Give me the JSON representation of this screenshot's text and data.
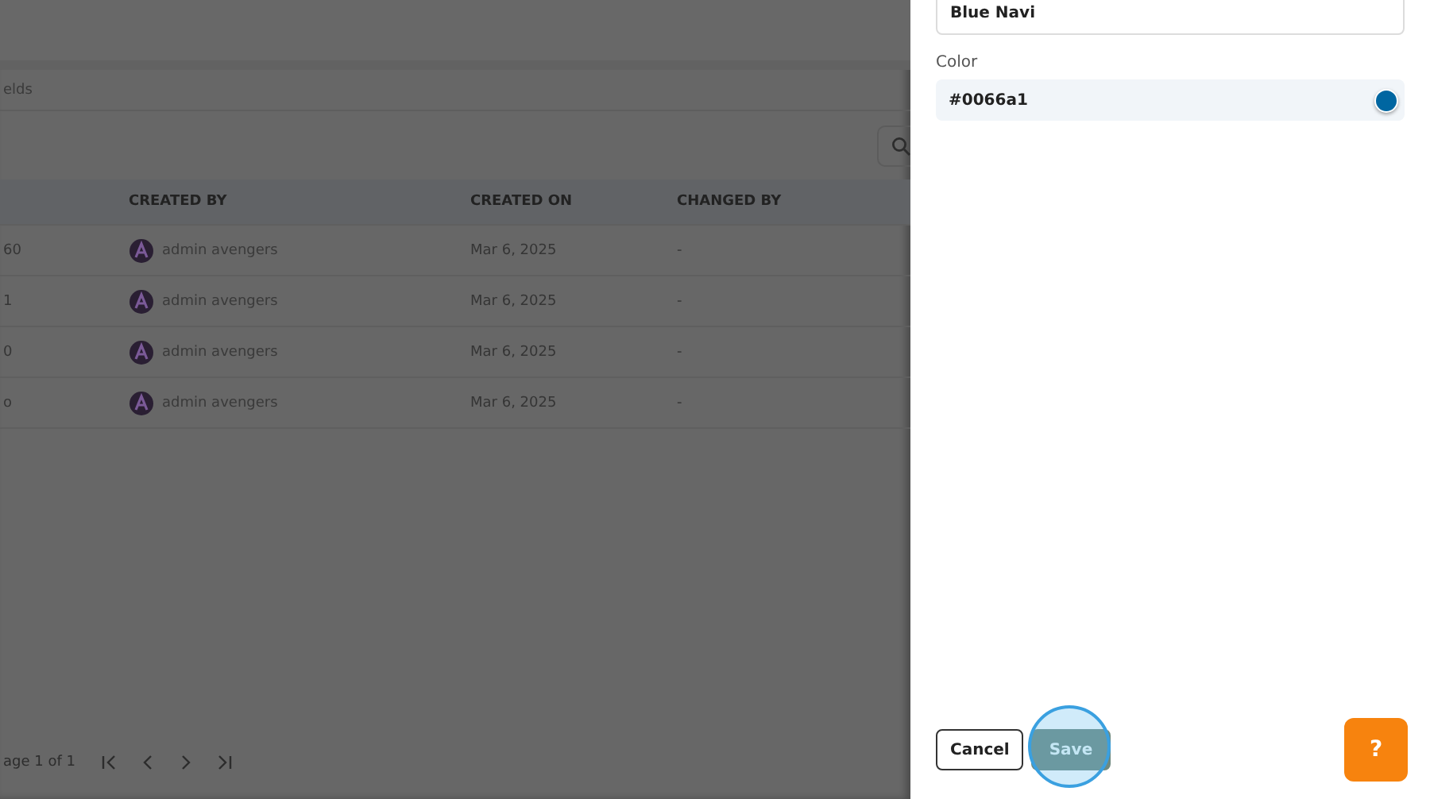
{
  "background_page": {
    "tab_label": "elds",
    "table": {
      "columns": [
        "",
        "CREATED BY",
        "CREATED ON",
        "CHANGED BY"
      ],
      "rows": [
        [
          "60",
          "admin avengers",
          "Mar 6, 2025",
          "-"
        ],
        [
          "1",
          "admin avengers",
          "Mar 6, 2025",
          "-"
        ],
        [
          "0",
          "admin avengers",
          "Mar 6, 2025",
          "-"
        ],
        [
          "o",
          "admin avengers",
          "Mar 6, 2025",
          "-"
        ]
      ]
    },
    "pagination": {
      "label": "age 1 of 1"
    }
  },
  "panel": {
    "name_field": {
      "value": "Blue Navi"
    },
    "color_field": {
      "label": "Color",
      "value": "#0066a1",
      "color": "#0066a1"
    },
    "buttons": [
      {
        "label": "Cancel",
        "kind": "secondary",
        "disabled": false
      },
      {
        "label": "Save",
        "kind": "primary",
        "disabled": true
      }
    ]
  },
  "help_button": {
    "label": "?"
  }
}
